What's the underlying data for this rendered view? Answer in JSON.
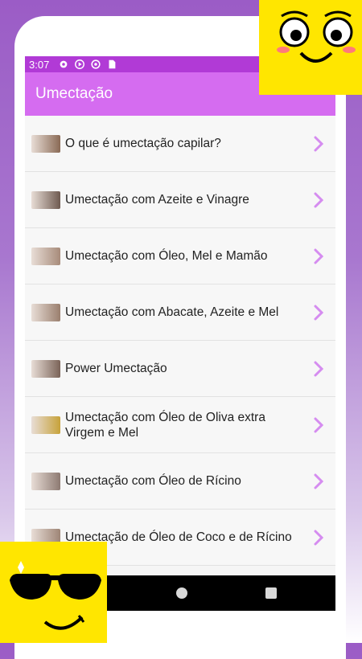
{
  "status_bar": {
    "time": "3:07",
    "icons": [
      "gear-icon",
      "play-store-icon",
      "sync-icon",
      "sd-card-icon"
    ]
  },
  "app_bar": {
    "title": "Umectação"
  },
  "list": {
    "items": [
      {
        "label": "O que é umectação capilar?",
        "thumb_color": "#8a6a55"
      },
      {
        "label": "Umectação com Azeite e Vinagre",
        "thumb_color": "#6e5a50"
      },
      {
        "label": "Umectação com Óleo, Mel e Mamão",
        "thumb_color": "#a78b7a"
      },
      {
        "label": "Umectação com Abacate, Azeite e Mel",
        "thumb_color": "#9a7f6e"
      },
      {
        "label": "Power Umectação",
        "thumb_color": "#7a6358"
      },
      {
        "label": "Umectação com Óleo de Oliva extra Virgem e Mel",
        "thumb_color": "#c7a23a"
      },
      {
        "label": "Umectação com Óleo de Rícino",
        "thumb_color": "#8d7a72"
      },
      {
        "label": "Umectação de Óleo de Coco e de Rícino",
        "thumb_color": "#9e8576"
      }
    ],
    "chevron_color": "#d58cf0"
  },
  "nav_bar": {
    "buttons": [
      "home-button",
      "recents-button"
    ]
  },
  "stickers": [
    "smiley-face-sticker",
    "cool-sunglasses-face-sticker"
  ]
}
